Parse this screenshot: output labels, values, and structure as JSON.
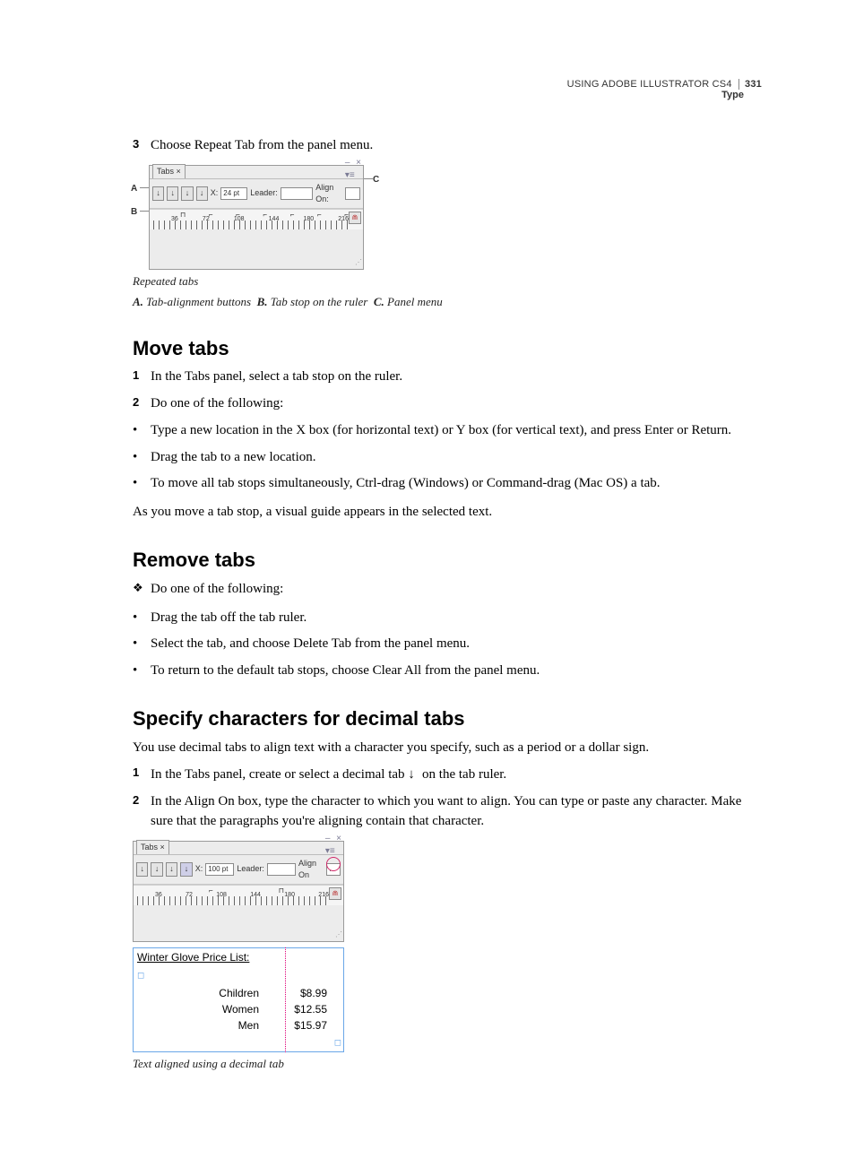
{
  "header": {
    "product": "USING ADOBE ILLUSTRATOR CS4",
    "page": "331",
    "section": "Type"
  },
  "step3": {
    "num": "3",
    "text": "Choose Repeat Tab from the panel menu."
  },
  "fig1": {
    "panel_tab": "Tabs",
    "x_label": "X:",
    "x_value": "24 pt",
    "leader_label": "Leader:",
    "align_label": "Align On:",
    "ruler_numbers": [
      "36",
      "72",
      "108",
      "144",
      "180",
      "216"
    ],
    "callouts": {
      "A": "A",
      "B": "B",
      "C": "C"
    },
    "caption_title": "Repeated tabs",
    "legend": {
      "A_key": "A.",
      "A_text": "Tab-alignment buttons",
      "B_key": "B.",
      "B_text": "Tab stop on the ruler",
      "C_key": "C.",
      "C_text": "Panel menu"
    }
  },
  "move": {
    "heading": "Move tabs",
    "s1n": "1",
    "s1": "In the Tabs panel, select a tab stop on the ruler.",
    "s2n": "2",
    "s2": "Do one of the following:",
    "b1": "Type a new location in the X box (for horizontal text) or Y box (for vertical text), and press Enter or Return.",
    "b2": "Drag the tab to a new location.",
    "b3": "To move all tab stops simultaneously, Ctrl-drag (Windows) or Command-drag (Mac OS) a tab.",
    "after": "As you move a tab stop, a visual guide appears in the selected text."
  },
  "remove": {
    "heading": "Remove tabs",
    "lead": "Do one of the following:",
    "b1": "Drag the tab off the tab ruler.",
    "b2": "Select the tab, and choose Delete Tab from the panel menu.",
    "b3": "To return to the default tab stops, choose Clear All from the panel menu."
  },
  "decimal": {
    "heading": "Specify characters for decimal tabs",
    "intro": "You use decimal tabs to align text with a character you specify, such as a period or a dollar sign.",
    "s1n": "1",
    "s1a": "In the Tabs panel, create or select a decimal tab ",
    "s1b": " on the tab ruler.",
    "s2n": "2",
    "s2": "In the Align On box, type the character to which you want to align. You can type or paste any character. Make sure that the paragraphs you're aligning contain that character."
  },
  "fig2": {
    "panel_tab": "Tabs",
    "x_label": "X:",
    "x_value": "100 pt",
    "leader_label": "Leader:",
    "align_label": "Align On",
    "align_value": ".",
    "ruler_numbers": [
      "36",
      "72",
      "108",
      "144",
      "180",
      "216"
    ],
    "price_title": "Winter Glove Price List:",
    "rows": [
      {
        "name": "Children",
        "price": "$8.99"
      },
      {
        "name": "Women",
        "price": "$12.55"
      },
      {
        "name": "Men",
        "price": "$15.97"
      }
    ],
    "caption": "Text aligned using a decimal tab"
  }
}
